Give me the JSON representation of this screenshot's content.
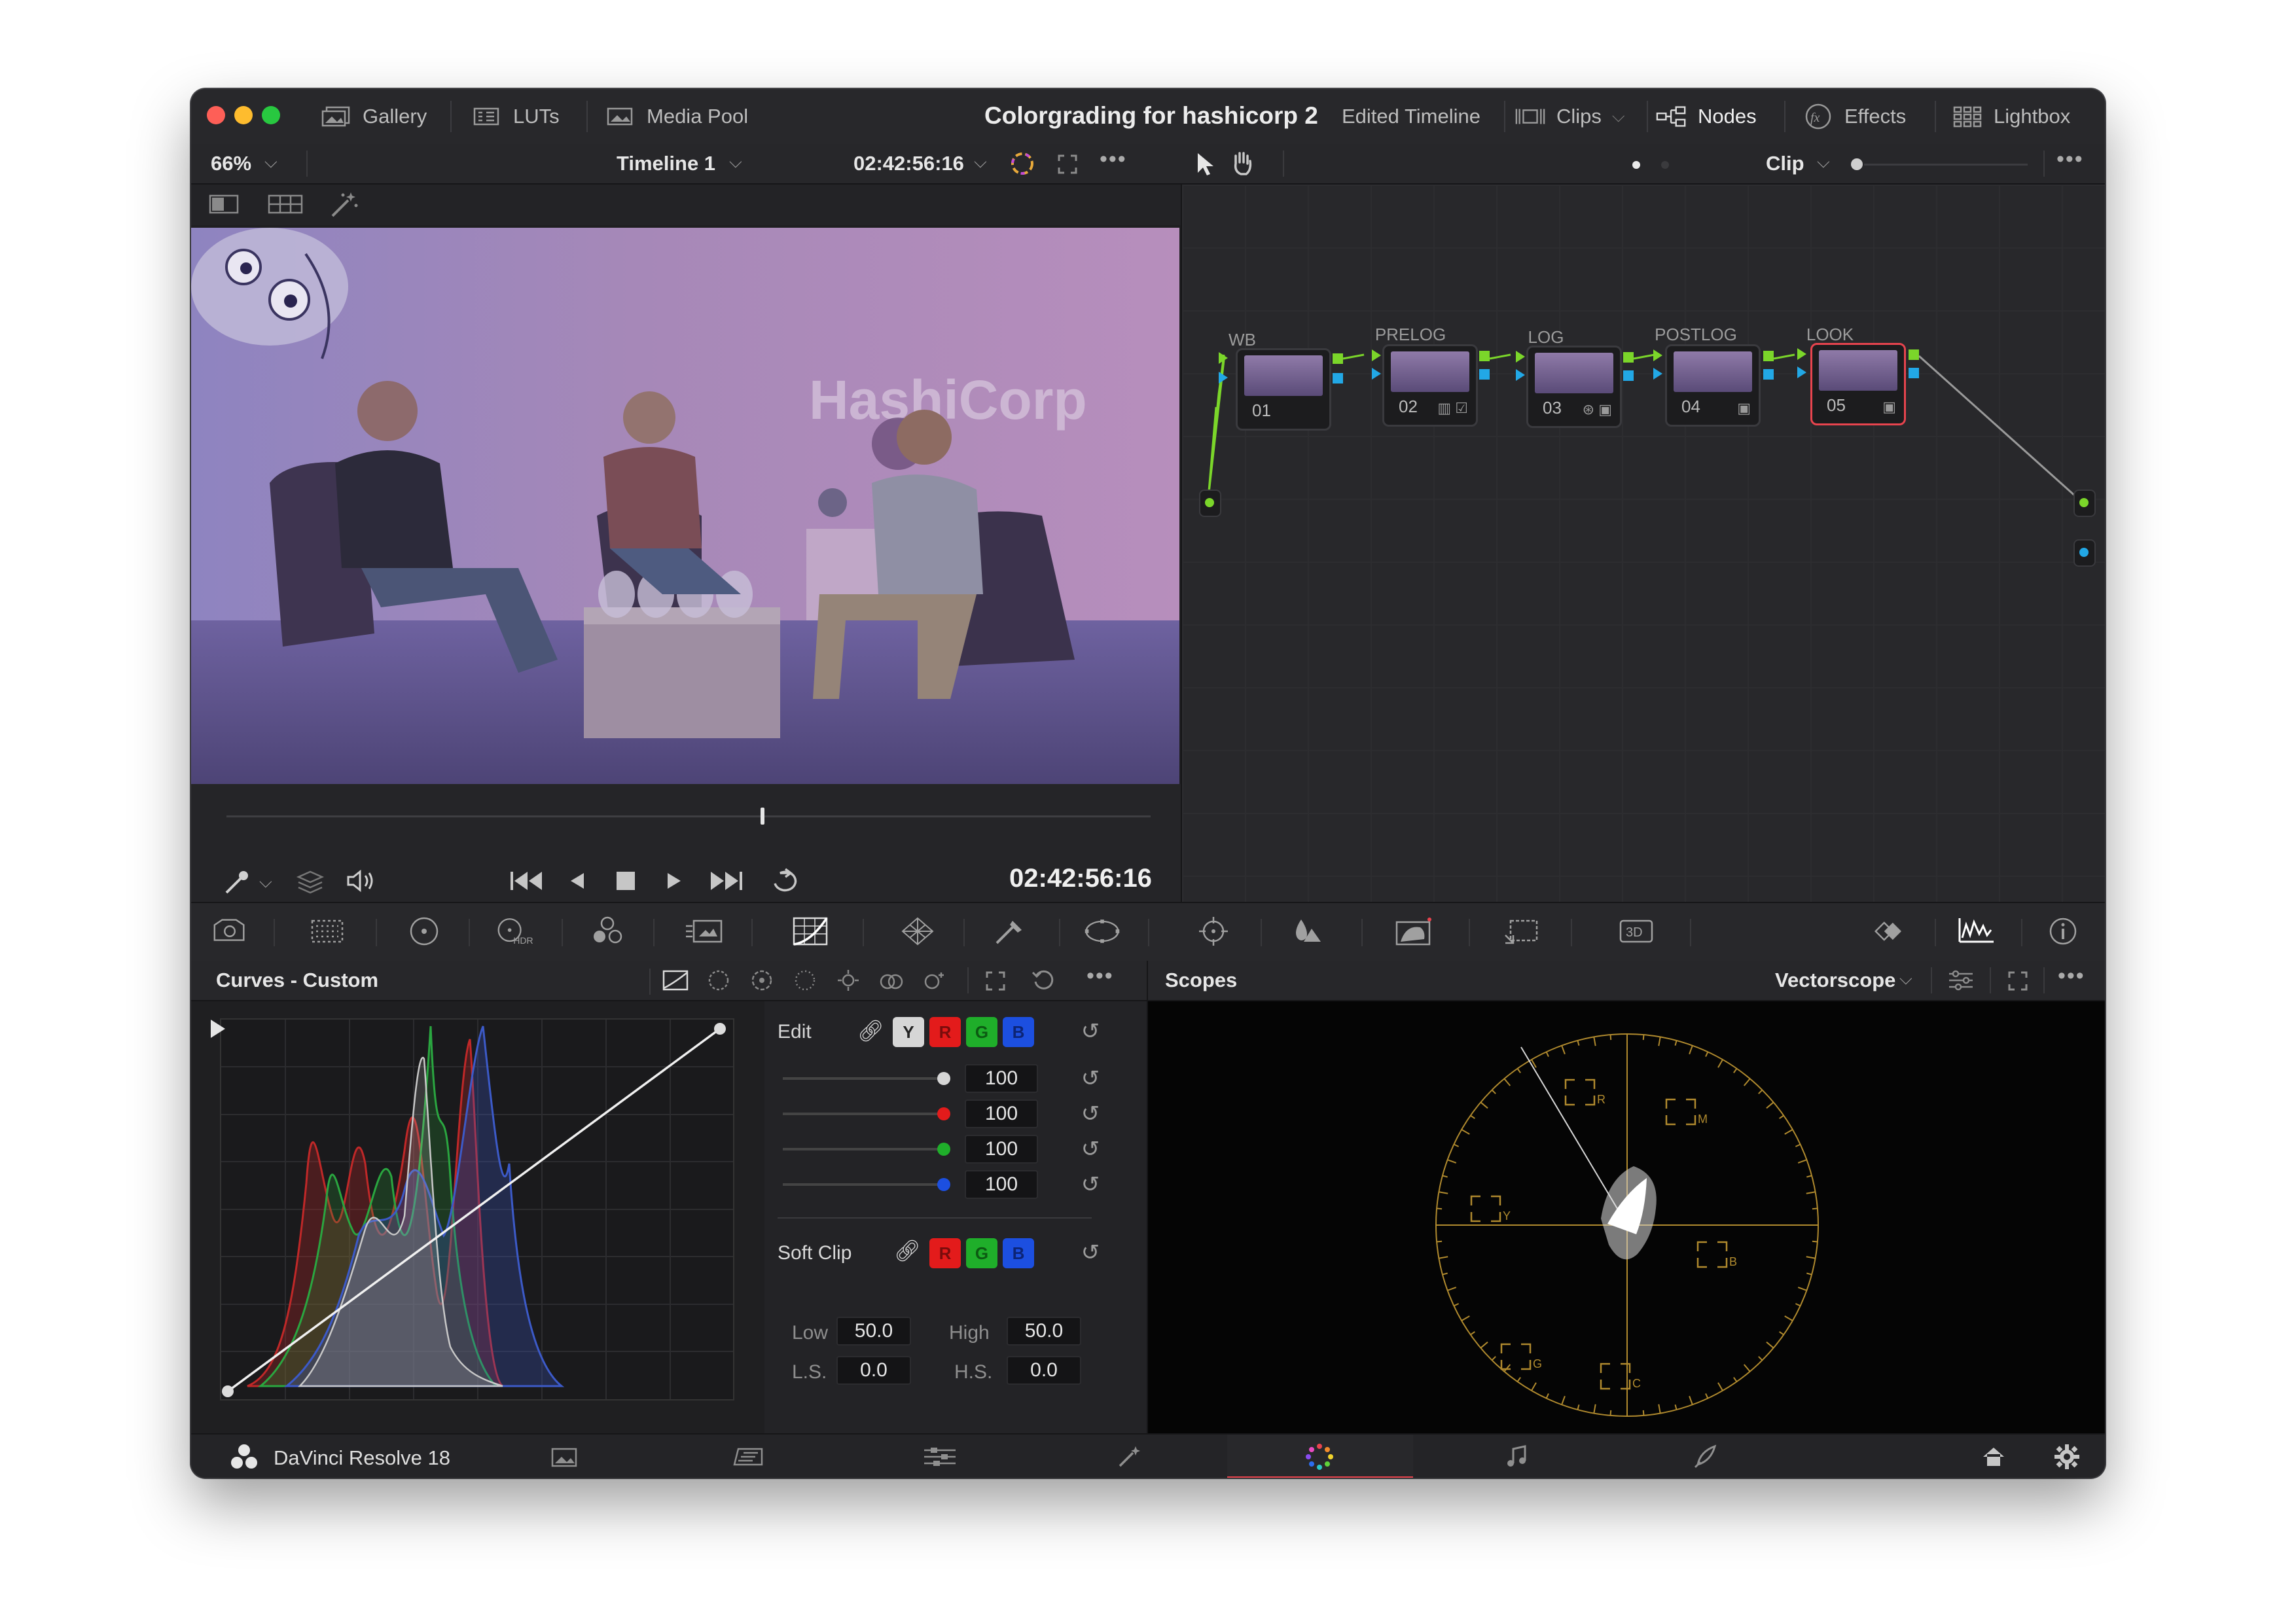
{
  "topbar": {
    "gallery": "Gallery",
    "luts": "LUTs",
    "media_pool": "Media Pool",
    "project_title": "Colorgrading for hashicorp 2",
    "timeline": "Edited Timeline",
    "clips": "Clips",
    "nodes": "Nodes",
    "effects": "Effects",
    "lightbox": "Lightbox"
  },
  "viewer": {
    "zoom": "66%",
    "timeline_name": "Timeline 1",
    "timecode_header": "02:42:56:16",
    "timecode": "02:42:56:16",
    "watermark": "HashiCorp",
    "playhead_progress": 0.58
  },
  "node_editor": {
    "mode": "Clip",
    "nodes": [
      {
        "label": "WB",
        "number": "01"
      },
      {
        "label": "PRELOG",
        "number": "02"
      },
      {
        "label": "LOG",
        "number": "03"
      },
      {
        "label": "POSTLOG",
        "number": "04"
      },
      {
        "label": "LOOK",
        "number": "05"
      }
    ]
  },
  "curves": {
    "title": "Curves - Custom",
    "edit_label": "Edit",
    "channels": [
      "Y",
      "R",
      "G",
      "B"
    ],
    "intensity_values": [
      "100",
      "100",
      "100",
      "100"
    ],
    "soft_clip_label": "Soft Clip",
    "soft_channels": [
      "R",
      "G",
      "B"
    ],
    "low_label": "Low",
    "low_value": "50.0",
    "high_label": "High",
    "high_value": "50.0",
    "ls_label": "L.S.",
    "ls_value": "0.0",
    "hs_label": "H.S.",
    "hs_value": "0.0"
  },
  "scopes": {
    "title": "Scopes",
    "type": "Vectorscope",
    "targets": [
      "R",
      "M",
      "Y",
      "B",
      "G",
      "C"
    ]
  },
  "footer": {
    "app_name": "DaVinci Resolve 18"
  },
  "colors": {
    "red": "#e31b1b",
    "green": "#1fae2a",
    "blue": "#1c4fe0",
    "accent_red": "#e8444e",
    "scope_gold": "#b08a2e"
  }
}
